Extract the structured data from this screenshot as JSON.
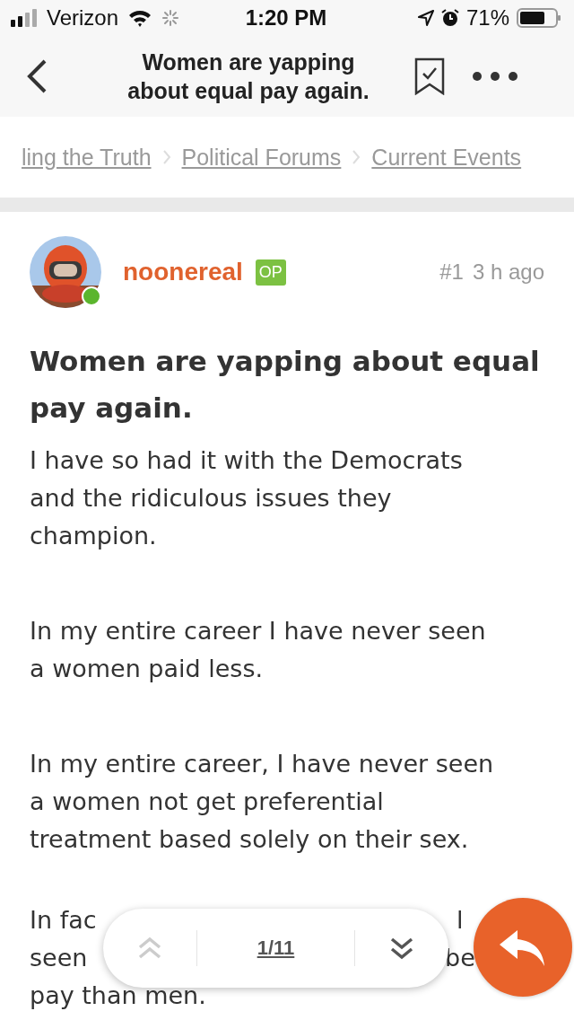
{
  "status_bar": {
    "carrier": "Verizon",
    "time": "1:20 PM",
    "battery": "71%"
  },
  "nav_bar": {
    "title": "Women are yapping about equal pay again."
  },
  "breadcrumbs": [
    "ling the Truth",
    "Political Forums",
    "Current Events"
  ],
  "post": {
    "author": "noonereal",
    "online": true,
    "badge": "OP",
    "number": "#1",
    "time": "3 h ago",
    "title": "Women are yapping about equal pay again.",
    "paragraphs": [
      "I have so had it with the Democrats and the ridiculous issues they champion.",
      "In my entire career I have never seen a women paid less.",
      "In my entire career, I have never seen a women not get preferential treatment based solely on their sex."
    ],
    "covered_lines": [
      {
        "left": "In fac",
        "right": "l"
      },
      {
        "left": "seen",
        "right": "be"
      },
      {
        "left": "pay than men."
      }
    ]
  },
  "pager": {
    "position": "1/11",
    "up_disabled": true,
    "down_disabled": false
  }
}
